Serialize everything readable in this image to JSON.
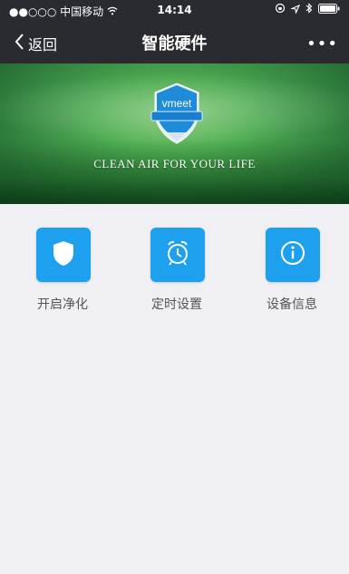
{
  "status_bar": {
    "carrier": "●●○○○ 中国移动",
    "time": "14:14"
  },
  "nav": {
    "back_label": "返回",
    "title": "智能硬件",
    "more_label": "•••"
  },
  "banner": {
    "brand": "vmeet",
    "tagline": "CLEAN AIR FOR YOUR LIFE"
  },
  "actions": [
    {
      "label": "开启净化",
      "icon": "shield-icon"
    },
    {
      "label": "定时设置",
      "icon": "alarm-clock-icon"
    },
    {
      "label": "设备信息",
      "icon": "info-icon"
    }
  ],
  "colors": {
    "nav_bg": "#2a2b30",
    "accent": "#1da0ee",
    "page_bg": "#efeff4"
  }
}
